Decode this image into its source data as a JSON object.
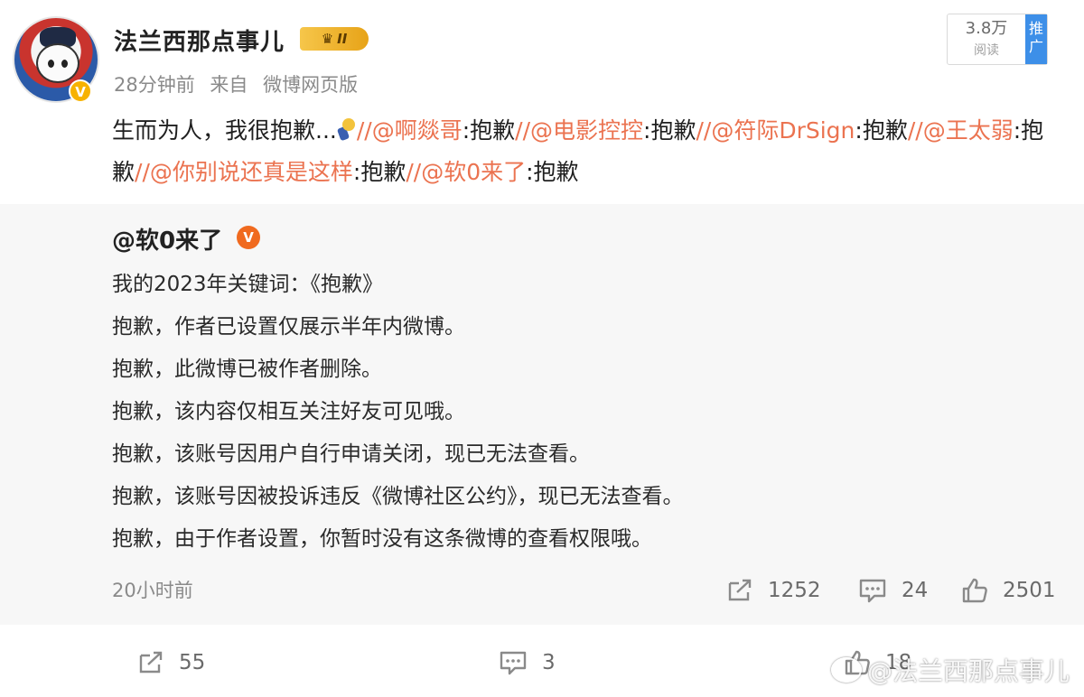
{
  "post": {
    "username": "法兰西那点事儿",
    "rank_badge": "II",
    "time": "28分钟前",
    "source_prefix": "来自",
    "source": "微博网页版",
    "reads_count": "3.8万",
    "reads_label": "阅读",
    "promote_label": "推广",
    "text_lead": "生而为人，我很抱歉...",
    "repost_chain": [
      {
        "sep": "//",
        "user": "@啊燚哥",
        "text": ":抱歉"
      },
      {
        "sep": "//",
        "user": "@电影控控",
        "text": ":抱歉"
      },
      {
        "sep": "//",
        "user": "@符际DrSign",
        "text": ":抱歉"
      },
      {
        "sep": "//",
        "user": "@王太弱",
        "text": ":抱歉"
      },
      {
        "sep": "//",
        "user": "@你别说还真是这样",
        "text": ":抱歉"
      },
      {
        "sep": "//",
        "user": "@软0来了",
        "text": ":抱歉"
      }
    ]
  },
  "quoted": {
    "author": "@软0来了",
    "lines": [
      "我的2023年关键词：《抱歉》",
      "抱歉，作者已设置仅展示半年内微博。",
      "抱歉，此微博已被作者删除。",
      "抱歉，该内容仅相互关注好友可见哦。",
      "抱歉，该账号因用户自行申请关闭，现已无法查看。",
      "抱歉，该账号因被投诉违反《微博社区公约》，现已无法查看。",
      "抱歉，由于作者设置，你暂时没有这条微博的查看权限哦。"
    ],
    "time": "20小时前",
    "reposts": "1252",
    "comments": "24",
    "likes": "2501"
  },
  "actions": {
    "reposts": "55",
    "comments": "3",
    "likes": "18"
  },
  "watermark": "@法兰西那点事儿"
}
